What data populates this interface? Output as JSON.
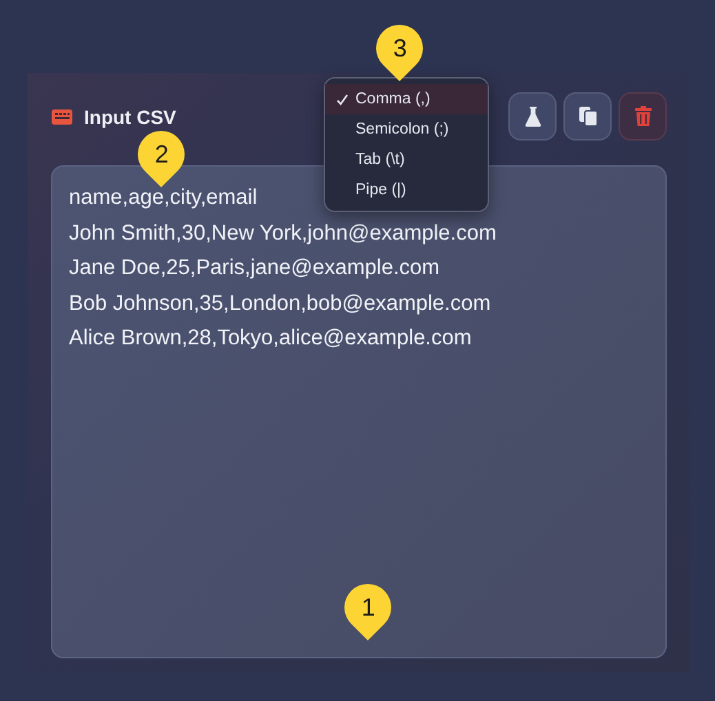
{
  "panel": {
    "title": "Input CSV"
  },
  "toolbar": {
    "buttons": [
      {
        "kind": "sample"
      },
      {
        "kind": "copy"
      },
      {
        "kind": "clear"
      }
    ]
  },
  "delimiter_menu": {
    "items": [
      {
        "label": "Comma (,)",
        "selected": true
      },
      {
        "label": "Semicolon (;)",
        "selected": false
      },
      {
        "label": "Tab (\\t)",
        "selected": false
      },
      {
        "label": "Pipe (|)",
        "selected": false
      }
    ]
  },
  "editor": {
    "lines": [
      "name,age,city,email",
      "John Smith,30,New York,john@example.com",
      "Jane Doe,25,Paris,jane@example.com",
      "Bob Johnson,35,London,bob@example.com",
      "Alice Brown,28,Tokyo,alice@example.com"
    ]
  },
  "markers": [
    {
      "label": "1"
    },
    {
      "label": "2"
    },
    {
      "label": "3"
    }
  ]
}
